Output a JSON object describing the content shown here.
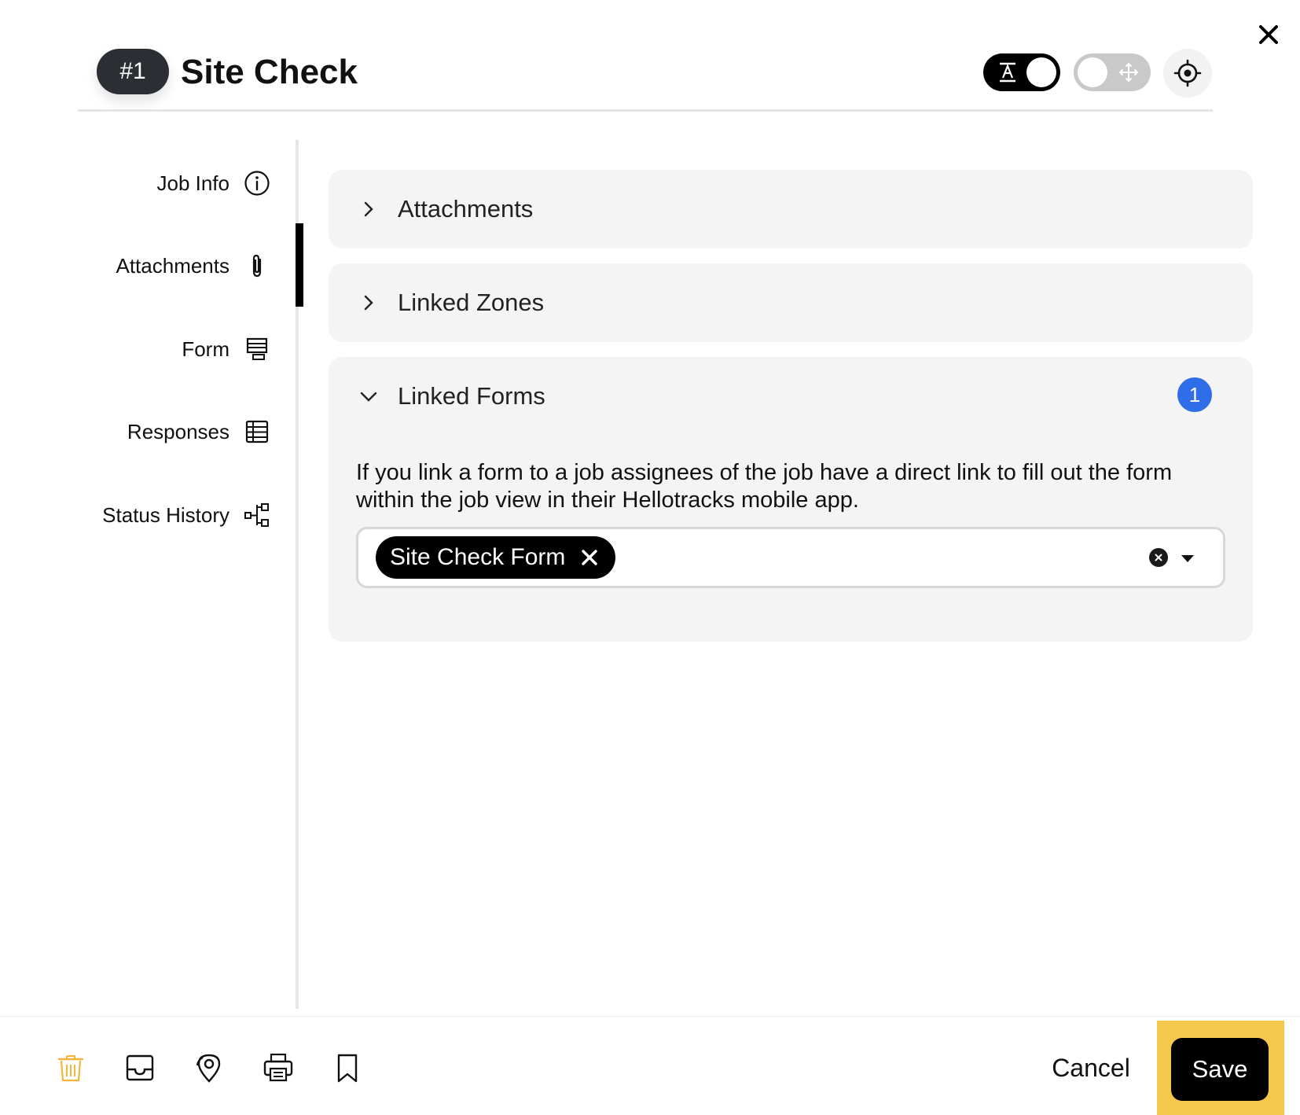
{
  "header": {
    "job_number": "#1",
    "title": "Site Check",
    "icons": [
      "close-icon",
      "text-toggle-icon",
      "move-toggle-icon",
      "locate-icon"
    ]
  },
  "sidebar": {
    "items": [
      {
        "label": "Job Info",
        "icon": "info-icon"
      },
      {
        "label": "Attachments",
        "icon": "paperclip-icon",
        "active": true
      },
      {
        "label": "Form",
        "icon": "form-icon"
      },
      {
        "label": "Responses",
        "icon": "table-icon"
      },
      {
        "label": "Status History",
        "icon": "hierarchy-icon"
      }
    ]
  },
  "panels": {
    "attachments": {
      "label": "Attachments",
      "expanded": false
    },
    "linked_zones": {
      "label": "Linked Zones",
      "expanded": false
    },
    "linked_forms": {
      "label": "Linked Forms",
      "expanded": true,
      "count": "1",
      "description": "If you link a form to a job assignees of the job have a direct link to fill out the form within the job view in their Hellotracks mobile app.",
      "selected_form": "Site Check Form"
    }
  },
  "footer": {
    "icons": [
      "trash-icon",
      "inbox-icon",
      "location-pin-icon",
      "print-icon",
      "bookmark-icon"
    ],
    "cancel_label": "Cancel",
    "save_label": "Save"
  },
  "colors": {
    "accent_blue": "#2f6ee8",
    "highlight_yellow": "#f4c84a",
    "trash_orange": "#f2b63c",
    "panel_bg": "#f4f4f4"
  }
}
